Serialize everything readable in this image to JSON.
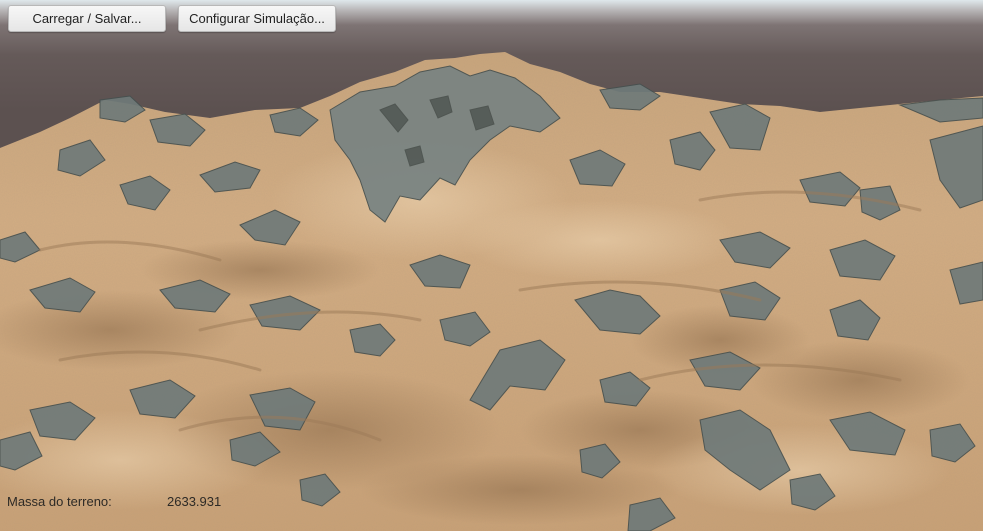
{
  "toolbar": {
    "load_save_label": "Carregar / Salvar...",
    "configure_label": "Configurar Simulação..."
  },
  "stats": {
    "terrain_mass_label": "Massa do terreno:",
    "terrain_mass_value": "2633.931"
  },
  "colors": {
    "sky": "#5f5554",
    "sand": "#d2aa7e",
    "sand_shadow": "#a4825e",
    "rock": "#6f7a79",
    "rock_dark": "#46504f",
    "button_bg": "#efefef"
  }
}
